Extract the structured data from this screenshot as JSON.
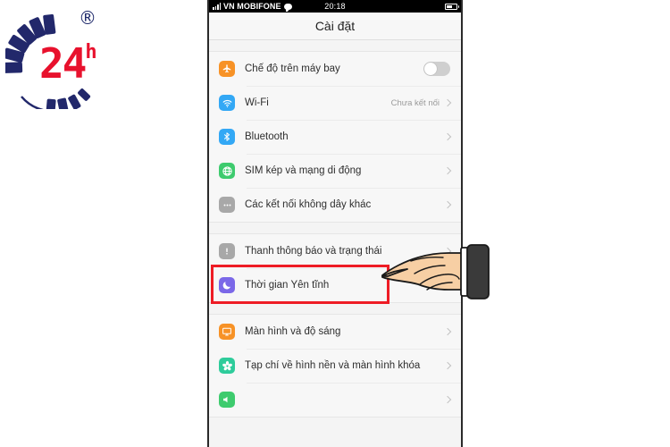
{
  "logo": {
    "name": "24h-logo",
    "digits": "24",
    "superscript": "h",
    "registered_mark": "®",
    "arc_color": "#22286b",
    "digit_color": "#e8112d"
  },
  "phone": {
    "status_bar": {
      "signal_icon": "signal-bars-icon",
      "carrier": "VN MOBIFONE",
      "message_icon": "message-bubble-icon",
      "time": "20:18",
      "battery_icon": "battery-icon",
      "battery_level": 55
    },
    "header": {
      "title": "Cài đặt"
    },
    "groups": [
      {
        "rows": [
          {
            "icon": "airplane-icon",
            "icon_color": "#f79226",
            "label": "Chế độ trên máy bay",
            "control": "toggle",
            "toggle_on": false,
            "value": ""
          },
          {
            "icon": "wifi-icon",
            "icon_color": "#33a8f5",
            "label": "Wi-Fi",
            "control": "chevron",
            "value": "Chưa kết nối"
          },
          {
            "icon": "bluetooth-icon",
            "icon_color": "#33a8f5",
            "label": "Bluetooth",
            "control": "chevron",
            "value": ""
          },
          {
            "icon": "globe-icon",
            "icon_color": "#3ecb6e",
            "label": "SIM kép và mạng di động",
            "control": "chevron",
            "value": ""
          },
          {
            "icon": "more-dots-icon",
            "icon_color": "#a8a8a8",
            "label": "Các kết nối không dây khác",
            "control": "chevron",
            "value": ""
          }
        ]
      },
      {
        "rows": [
          {
            "icon": "exclamation-icon",
            "icon_color": "#a8a8a8",
            "label": "Thanh thông báo và trạng thái",
            "control": "chevron",
            "value": "",
            "highlighted": true
          },
          {
            "icon": "moon-icon",
            "icon_color": "#7b68e8",
            "label": "Thời gian Yên tĩnh",
            "control": "chevron",
            "value": ""
          }
        ]
      },
      {
        "rows": [
          {
            "icon": "monitor-icon",
            "icon_color": "#f79226",
            "label": "Màn hình và độ sáng",
            "control": "chevron",
            "value": ""
          },
          {
            "icon": "flower-icon",
            "icon_color": "#2ecc9b",
            "label": "Tạp chí về hình nền và màn hình khóa",
            "control": "chevron",
            "value": ""
          },
          {
            "icon": "sound-icon",
            "icon_color": "#3ecb6e",
            "label": "",
            "control": "chevron",
            "value": ""
          }
        ]
      }
    ],
    "highlight": {
      "name": "highlight-box",
      "color": "#ee1c25"
    },
    "pointer": {
      "name": "pointing-hand-cursor",
      "skin_color": "#f5c79a",
      "sleeve_color": "#3a3a3a"
    }
  }
}
